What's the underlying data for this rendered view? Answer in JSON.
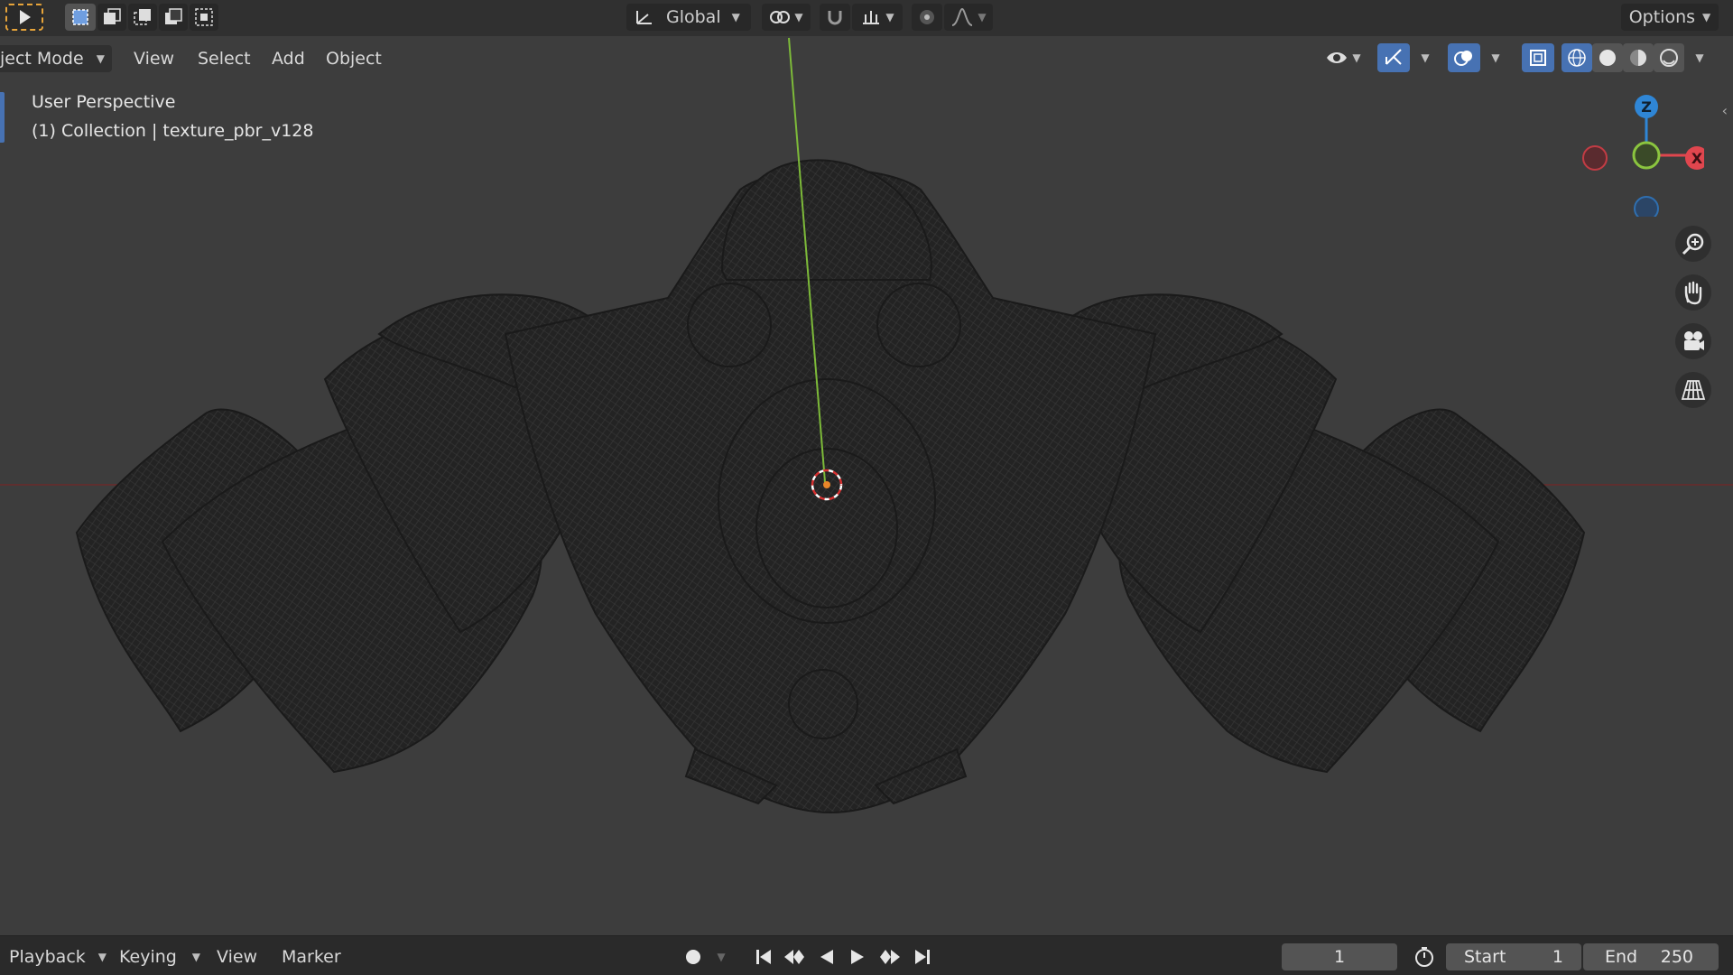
{
  "toolbar": {
    "orientation_label": "Global",
    "options_label": "Options"
  },
  "header": {
    "mode_label": "ject Mode",
    "menus": [
      "View",
      "Select",
      "Add",
      "Object"
    ]
  },
  "viewport": {
    "view_name": "User Perspective",
    "collection_info": "(1) Collection | texture_pbr_v128"
  },
  "gizmo": {
    "z_label": "Z",
    "x_label": "X"
  },
  "timeline": {
    "menus": [
      "Playback",
      "Keying",
      "View",
      "Marker"
    ],
    "current_frame": "1",
    "start_label": "Start",
    "start_value": "1",
    "end_label": "End",
    "end_value": "250"
  },
  "colors": {
    "background": "#3d3d3d",
    "header": "#303030",
    "accent": "#4772b3",
    "axis_x": "#e0464e",
    "axis_y": "#8bc53f",
    "axis_z": "#2f86d6",
    "mesh": "#242424"
  }
}
